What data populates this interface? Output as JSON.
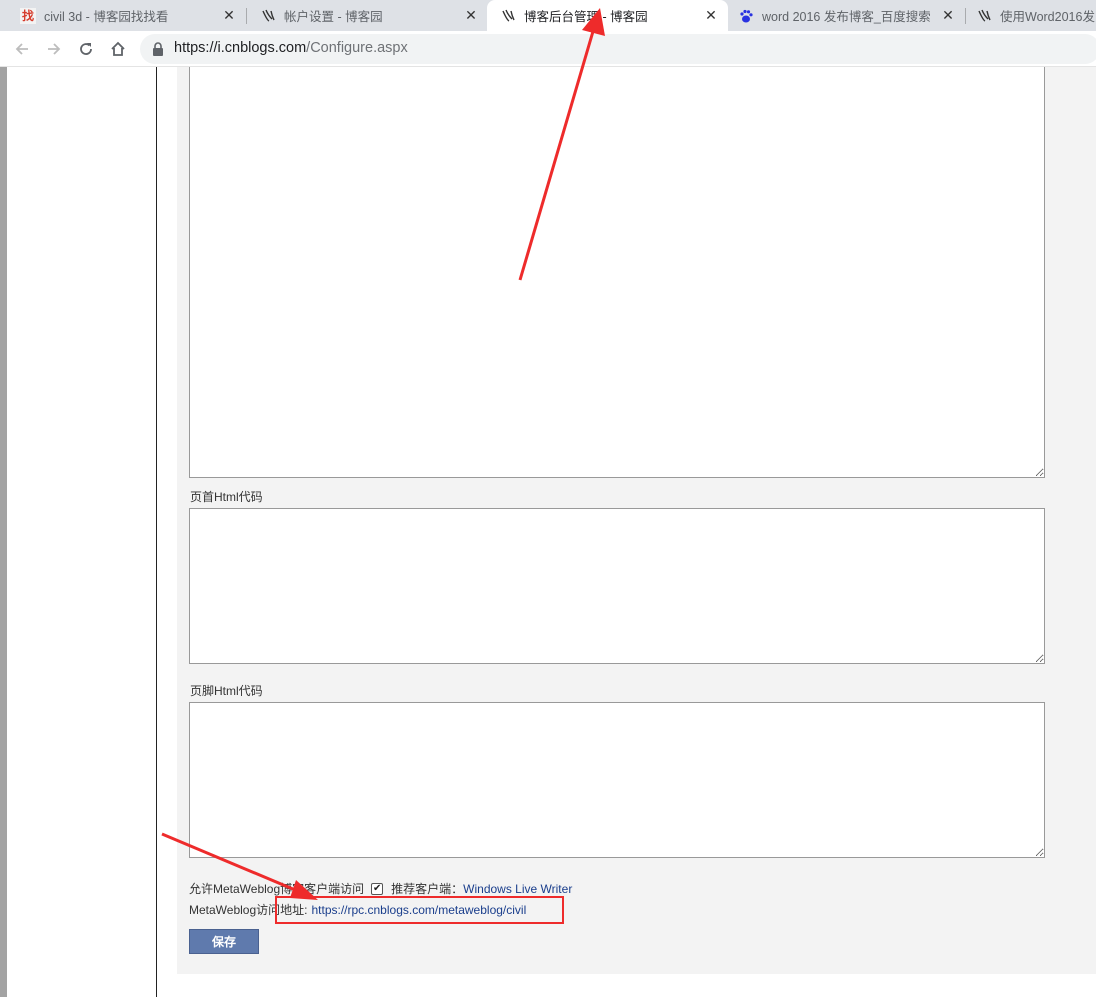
{
  "tabs": [
    {
      "title": "civil 3d - 博客园找找看",
      "favicon": "search-find-favicon",
      "active": false
    },
    {
      "title": "帐户设置 - 博客园",
      "favicon": "cnblogs-favicon",
      "active": false
    },
    {
      "title": "博客后台管理 - 博客园",
      "favicon": "cnblogs-favicon",
      "active": true
    },
    {
      "title": "word 2016 发布博客_百度搜索",
      "favicon": "baidu-paw-favicon",
      "active": false
    },
    {
      "title": "使用Word2016发",
      "favicon": "cnblogs-favicon",
      "active": false
    }
  ],
  "tab_favicon_text": {
    "find": "找"
  },
  "toolbar": {
    "url_host": "https://i.cnblogs.com",
    "url_path": "/Configure.aspx"
  },
  "form": {
    "header_html_label": "页首Html代码",
    "footer_html_label": "页脚Html代码",
    "metaweblog_allow_label": "允许MetaWeblog博客客户端访问",
    "metaweblog_allow_checked": true,
    "recommended_client_label": "推荐客户端：",
    "recommended_client_link": "Windows Live Writer",
    "metaweblog_url_label": "MetaWeblog访问地址:",
    "metaweblog_url": "https://rpc.cnblogs.com/metaweblog/civil",
    "save_label": "保存"
  },
  "colors": {
    "annotation_red": "#ee2b2b",
    "save_button": "#5f7aad",
    "link": "#1a3e8c"
  }
}
